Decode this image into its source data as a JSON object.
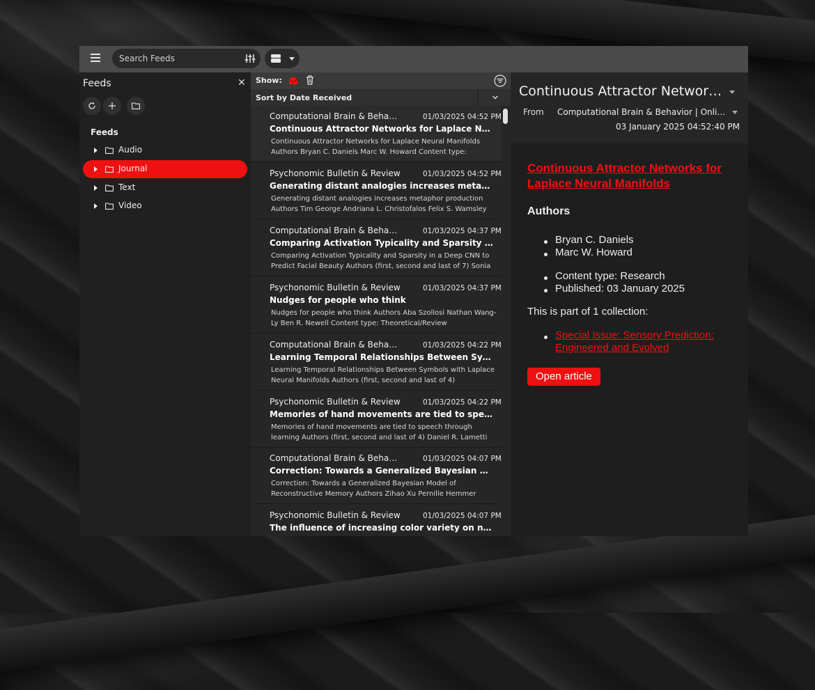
{
  "topbar": {
    "search_placeholder": "Search Feeds",
    "icons": [
      "menu-icon",
      "filter-sliders-icon",
      "view-mode-icon",
      "chevron-down-icon"
    ]
  },
  "sidebar": {
    "title": "Feeds",
    "close_glyph": "✕",
    "section_label": "Feeds",
    "folders": [
      {
        "label": "Audio",
        "selected": false
      },
      {
        "label": "Journal",
        "selected": true
      },
      {
        "label": "Text",
        "selected": false
      },
      {
        "label": "Video",
        "selected": false
      }
    ]
  },
  "list": {
    "show_label": "Show:",
    "sort_label": "Sort by Date Received",
    "items": [
      {
        "source": "Computational Brain & Behavior | Online first",
        "date": "01/03/2025 04:52 PM",
        "title": "Continuous Attractor Networks for Laplace Neural Manifolds",
        "snippet": "Continuous Attractor Networks for Laplace Neural Manifolds Authors Bryan C. Daniels Marc W. Howard Content type: Research"
      },
      {
        "source": "Psychonomic Bulletin & Review",
        "date": "01/03/2025 04:52 PM",
        "title": "Generating distant analogies increases metaphor production",
        "snippet": "Generating distant analogies increases metaphor production Authors Tim George Andriana L. Christofalos Felix S. Wamsley"
      },
      {
        "source": "Computational Brain & Behavior | Online first",
        "date": "01/03/2025 04:37 PM",
        "title": "Comparing Activation Typicality and Sparsity in a Deep CNN",
        "snippet": "Comparing Activation Typicality and Sparsity in a Deep CNN to Predict Facial Beauty Authors (first, second and last of 7) Sonia"
      },
      {
        "source": "Psychonomic Bulletin & Review",
        "date": "01/03/2025 04:37 PM",
        "title": "Nudges for people who think",
        "snippet": "Nudges for people who think Authors Aba Szollosi Nathan Wang-Ly Ben R. Newell Content type: Theoretical/Review"
      },
      {
        "source": "Computational Brain & Behavior | Online first",
        "date": "01/03/2025 04:22 PM",
        "title": "Learning Temporal Relationships Between Symbols with Laplace Neural Manifolds",
        "snippet": "Learning Temporal Relationships Between Symbols with Laplace Neural Manifolds Authors (first, second and last of 4)"
      },
      {
        "source": "Psychonomic Bulletin & Review",
        "date": "01/03/2025 04:22 PM",
        "title": "Memories of hand movements are tied to speech through learning",
        "snippet": "Memories of hand movements are tied to speech through learning Authors (first, second and last of 4) Daniel R. Lametti"
      },
      {
        "source": "Computational Brain & Behavior | Online first",
        "date": "01/03/2025 04:07 PM",
        "title": "Correction: Towards a Generalized Bayesian Model of Reconstructive Memory",
        "snippet": "Correction: Towards a Generalized Bayesian Model of Reconstructive Memory Authors Zihao Xu Pernille Hemmer"
      },
      {
        "source": "Psychonomic Bulletin & Review",
        "date": "01/03/2025 04:07 PM",
        "title": "The influence of increasing color variety on numerosity estimation",
        "snippet": ""
      }
    ]
  },
  "reader": {
    "title": "Continuous Attractor Networks for Laplace Neural Manifolds",
    "from_label": "From",
    "from_value": "Computational Brain & Behavior | Online first",
    "date": "03 January 2025 04:52:40 PM",
    "article_title": "Continuous Attractor Networks for Laplace Neural Manifolds",
    "authors_heading": "Authors",
    "authors": [
      "Bryan C. Daniels",
      "Marc W. Howard"
    ],
    "content_type": "Content type: Research",
    "published": "Published: 03 January 2025",
    "collection_text": "This is part of 1 collection:",
    "collection_link": "Special Issue: Sensory Prediction: Engineered and Evolved",
    "open_button": "Open article"
  },
  "colors": {
    "accent": "#ee1111",
    "topbar": "#4a4a4a",
    "panel": "#262626"
  }
}
